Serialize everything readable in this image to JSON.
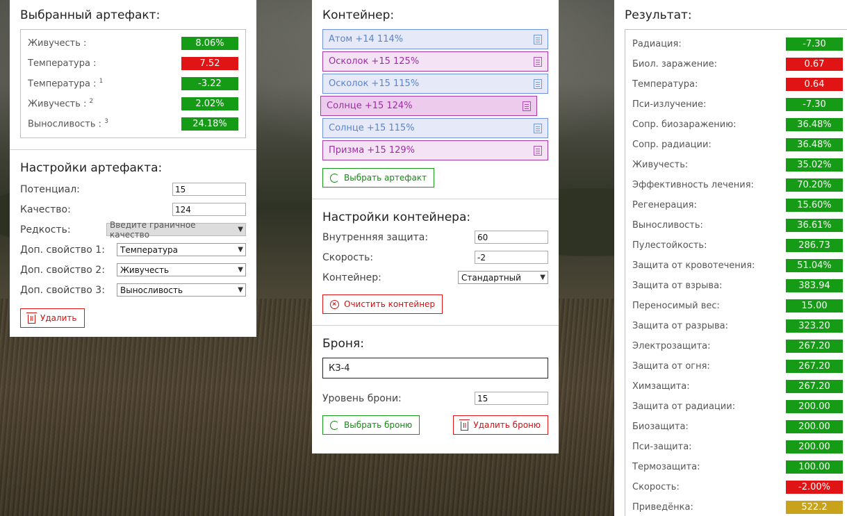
{
  "selected_artifact": {
    "title": "Выбранный артефакт:",
    "stats": [
      {
        "label": "Живучесть :",
        "sup": "",
        "value": "8.06%",
        "color": "g"
      },
      {
        "label": "Температура :",
        "sup": "",
        "value": "7.52",
        "color": "r"
      },
      {
        "label": "Температура :",
        "sup": "1",
        "value": "-3.22",
        "color": "g"
      },
      {
        "label": "Живучесть :",
        "sup": "2",
        "value": "2.02%",
        "color": "g"
      },
      {
        "label": "Выносливость :",
        "sup": "3",
        "value": "24.18%",
        "color": "g"
      }
    ]
  },
  "artifact_settings": {
    "title": "Настройки артефакта:",
    "potential_label": "Потенциал:",
    "potential_value": "15",
    "quality_label": "Качество:",
    "quality_value": "124",
    "rarity_label": "Редкость:",
    "rarity_value": "Введите граничное качество",
    "extra1_label": "Доп. свойство 1:",
    "extra1_value": "Температура",
    "extra2_label": "Доп. свойство 2:",
    "extra2_value": "Живучесть",
    "extra3_label": "Доп. свойство 3:",
    "extra3_value": "Выносливость",
    "delete_label": "Удалить"
  },
  "container": {
    "title": "Контейнер:",
    "artifacts": [
      {
        "label": "Атом +14 114%",
        "style": "blue"
      },
      {
        "label": "Осколок +15 125%",
        "style": "purple"
      },
      {
        "label": "Осколок +15 115%",
        "style": "blue"
      },
      {
        "label": "Солнце +15 124%",
        "style": "sel-active"
      },
      {
        "label": "Солнце +15 115%",
        "style": "blue"
      },
      {
        "label": "Призма +15 129%",
        "style": "purple"
      }
    ],
    "select_artifact_label": "Выбрать артефакт"
  },
  "container_settings": {
    "title": "Настройки контейнера:",
    "inner_protection_label": "Внутренняя защита:",
    "inner_protection_value": "60",
    "speed_label": "Скорость:",
    "speed_value": "-2",
    "container_label": "Контейнер:",
    "container_value": "Стандартный",
    "clear_label": "Очистить контейнер"
  },
  "armor": {
    "title": "Броня:",
    "name": "КЗ-4",
    "level_label": "Уровень брони:",
    "level_value": "15",
    "select_label": "Выбрать броню",
    "delete_label": "Удалить броню"
  },
  "result": {
    "title": "Результат:",
    "rows": [
      {
        "label": "Радиация:",
        "value": "-7.30",
        "color": "g"
      },
      {
        "label": "Биол. заражение:",
        "value": "0.67",
        "color": "r"
      },
      {
        "label": "Температура:",
        "value": "0.64",
        "color": "r"
      },
      {
        "label": "Пси-излучение:",
        "value": "-7.30",
        "color": "g"
      },
      {
        "label": "Сопр. биозаражению:",
        "value": "36.48%",
        "color": "g"
      },
      {
        "label": "Сопр. радиации:",
        "value": "36.48%",
        "color": "g"
      },
      {
        "label": "Живучесть:",
        "value": "35.02%",
        "color": "g"
      },
      {
        "label": "Эффективность лечения:",
        "value": "70.20%",
        "color": "g"
      },
      {
        "label": "Регенерация:",
        "value": "15.60%",
        "color": "g"
      },
      {
        "label": "Выносливость:",
        "value": "36.61%",
        "color": "g"
      },
      {
        "label": "Пулестойкость:",
        "value": "286.73",
        "color": "g"
      },
      {
        "label": "Защита от кровотечения:",
        "value": "51.04%",
        "color": "g"
      },
      {
        "label": "Защита от взрыва:",
        "value": "383.94",
        "color": "g"
      },
      {
        "label": "Переносимый вес:",
        "value": "15.00",
        "color": "g"
      },
      {
        "label": "Защита от разрыва:",
        "value": "323.20",
        "color": "g"
      },
      {
        "label": "Электрозащита:",
        "value": "267.20",
        "color": "g"
      },
      {
        "label": "Защита от огня:",
        "value": "267.20",
        "color": "g"
      },
      {
        "label": "Химзащита:",
        "value": "267.20",
        "color": "g"
      },
      {
        "label": "Защита от радиации:",
        "value": "200.00",
        "color": "g"
      },
      {
        "label": "Биозащита:",
        "value": "200.00",
        "color": "g"
      },
      {
        "label": "Пси-защита:",
        "value": "200.00",
        "color": "g"
      },
      {
        "label": "Термозащита:",
        "value": "100.00",
        "color": "g"
      },
      {
        "label": "Скорость:",
        "value": "-2.00%",
        "color": "r"
      },
      {
        "label": "Приведёнка:",
        "value": "522.2",
        "color": "y"
      }
    ]
  },
  "colors": {
    "green": "#169b16",
    "red": "#e01414",
    "gold": "#c9a21c",
    "blue_border": "#6f8fd8",
    "purple_border": "#a33aa8"
  }
}
